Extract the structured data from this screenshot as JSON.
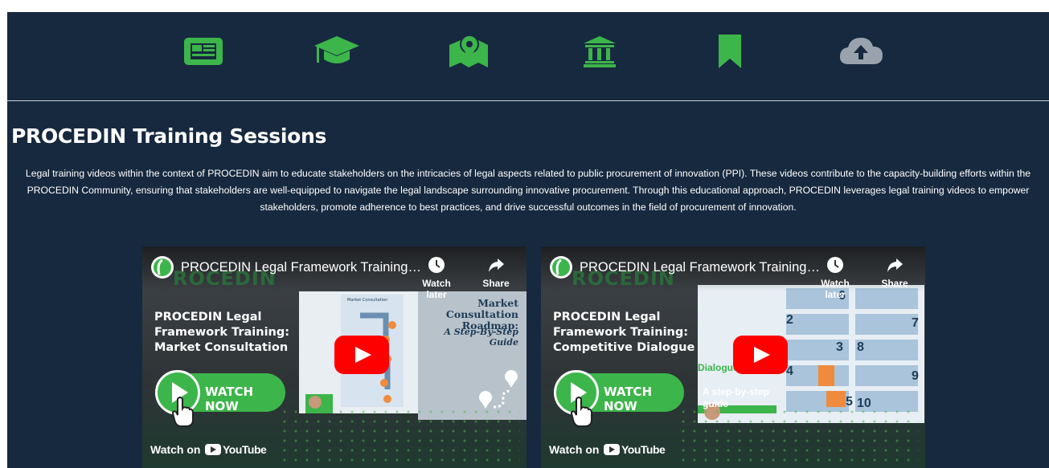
{
  "nav": {
    "icons": [
      {
        "name": "newspaper-icon"
      },
      {
        "name": "graduation-cap-icon"
      },
      {
        "name": "map-marker-icon"
      },
      {
        "name": "institution-icon"
      },
      {
        "name": "bookmark-icon"
      },
      {
        "name": "cloud-upload-icon"
      }
    ],
    "accent": "#3cb54a",
    "muted": "#9aa3ad"
  },
  "page": {
    "title": "PROCEDIN Training Sessions",
    "description": "Legal training videos within the context of PROCEDIN aim to educate stakeholders on the intricacies of legal aspects related to public procurement of innovation (PPI). These videos contribute to the capacity-building efforts within the PROCEDIN Community, ensuring that stakeholders are well-equipped to navigate the legal landscape surrounding innovative procurement. Through this educational approach, PROCEDIN leverages legal training videos to empower stakeholders, promote adherence to best practices, and drive successful outcomes in the field of procurement of innovation.",
    "background": "#17293f"
  },
  "videos": [
    {
      "title": "PROCEDIN Legal Framework Training:...",
      "ghost_brand": "ROCEDIN",
      "watch_later": "Watch later",
      "share": "Share",
      "thumb_heading": "PROCEDIN Legal Framework Training: Market Consultation",
      "watch_now": "WATCH NOW",
      "doc_title": "Market Consultation Roadmap:",
      "doc_subtitle": "A Step-By-Step Guide",
      "watch_on": "Watch on",
      "youtube": "YouTube"
    },
    {
      "title": "PROCEDIN Legal Framework Training:...",
      "ghost_brand": "ROCEDIN",
      "watch_later": "Watch later",
      "share": "Share",
      "thumb_heading": "PROCEDIN Legal Framework Training: Competitive Dialogue",
      "watch_now": "WATCH NOW",
      "doc_title": "Dialogue",
      "doc_subtitle": "A step-by-step guide",
      "watch_on": "Watch on",
      "youtube": "YouTube"
    }
  ]
}
